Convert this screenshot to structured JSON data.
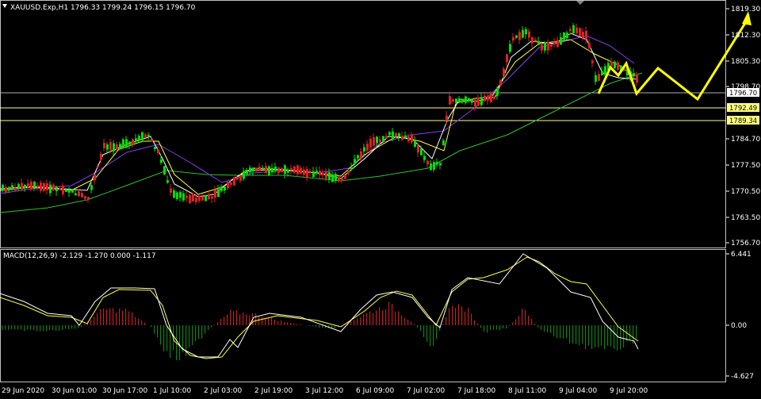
{
  "header": {
    "text": "XAUUSD.Exp,H1  1796.33 1799.24 1796.15 1796.70"
  },
  "price_axis": {
    "labels": [
      "1819.30",
      "1812.30",
      "1805.30",
      "1798.70",
      "1784.70",
      "1777.50",
      "1770.50",
      "1763.50",
      "1756.70"
    ],
    "bid_tag": "1796.70",
    "level_tags": [
      "1792.49",
      "1789.34"
    ]
  },
  "time_axis": {
    "labels": [
      "29 Jun 2020",
      "30 Jun 01:00",
      "30 Jun 17:00",
      "1 Jul 10:00",
      "2 Jul 03:00",
      "2 Jul 19:00",
      "3 Jul 12:00",
      "6 Jul 09:00",
      "7 Jul 02:00",
      "7 Jul 18:00",
      "8 Jul 11:00",
      "9 Jul 04:00",
      "9 Jul 20:00"
    ]
  },
  "macd": {
    "header": "MACD(12,26,9) -2.129 -1.270 0.000 -1.117",
    "axis_labels": [
      "6.441",
      "0.00",
      "-4.627"
    ]
  },
  "colors": {
    "background": "#000000",
    "bull_candle": "#00e000",
    "bear_candle": "#e02020",
    "ma_fast": "#ffffff",
    "ma_mid": "#ffff40",
    "ma_slow_purple": "#8a3cf0",
    "ma_slow_green": "#30c030",
    "level_line": "#ffff80",
    "bid_line": "#b0b0b0",
    "forecast_arrow": "#ffff00",
    "hist_pos": "#c02020",
    "hist_neg": "#108010"
  }
}
